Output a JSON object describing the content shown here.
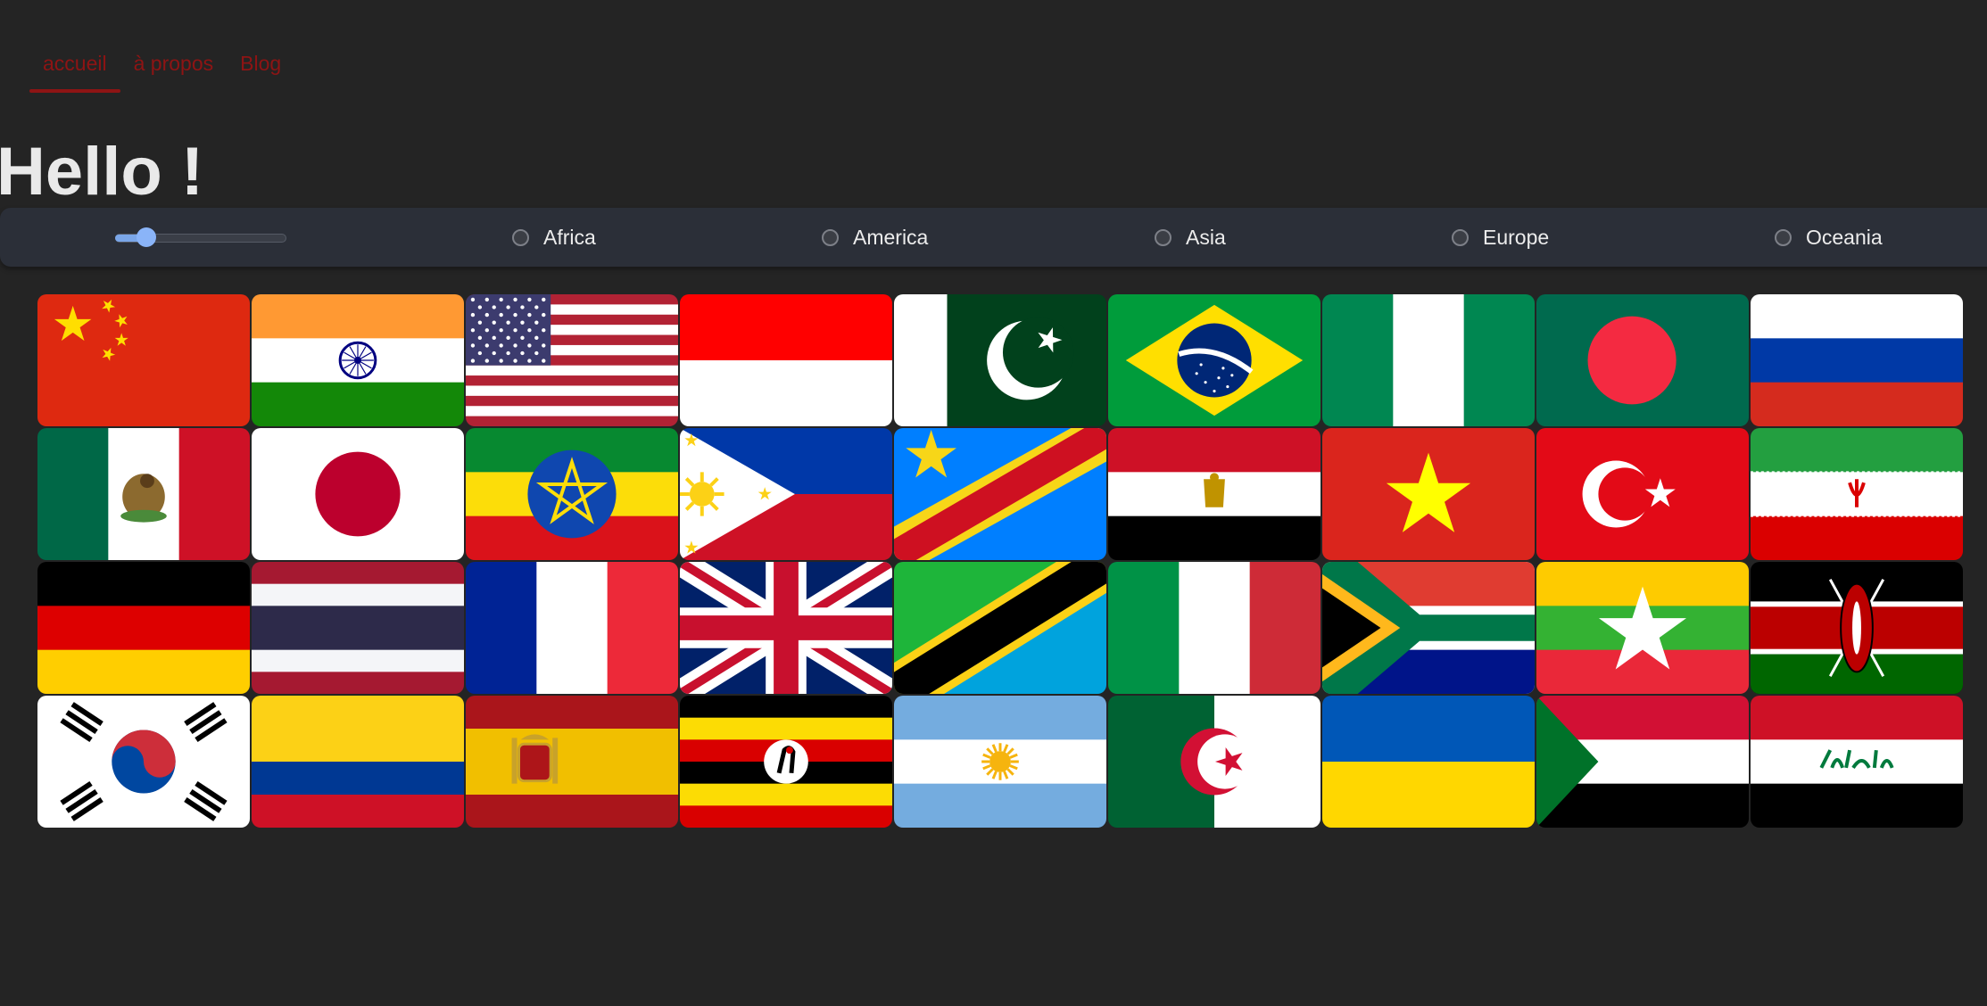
{
  "nav": {
    "items": [
      {
        "label": "accueil",
        "active": true
      },
      {
        "label": "à propos",
        "active": false
      },
      {
        "label": "Blog",
        "active": false
      }
    ]
  },
  "page": {
    "title": "Hello !"
  },
  "filters": {
    "slider_value": 0.18,
    "regions": [
      "Africa",
      "America",
      "Asia",
      "Europe",
      "Oceania"
    ]
  },
  "flags": [
    "china",
    "india",
    "united-states",
    "indonesia",
    "pakistan",
    "brazil",
    "nigeria",
    "bangladesh",
    "russia",
    "mexico",
    "japan",
    "ethiopia",
    "philippines",
    "dr-congo",
    "egypt",
    "vietnam",
    "turkey",
    "iran",
    "germany",
    "thailand",
    "france",
    "united-kingdom",
    "tanzania",
    "italy",
    "south-africa",
    "myanmar",
    "kenya",
    "south-korea",
    "colombia",
    "spain",
    "uganda",
    "argentina",
    "algeria",
    "ukraine",
    "sudan",
    "iraq"
  ],
  "colors": {
    "background": "#242424",
    "nav_link": "#8e1414",
    "bar": "#2b2f38",
    "slider_accent": "#8ab4f8"
  }
}
